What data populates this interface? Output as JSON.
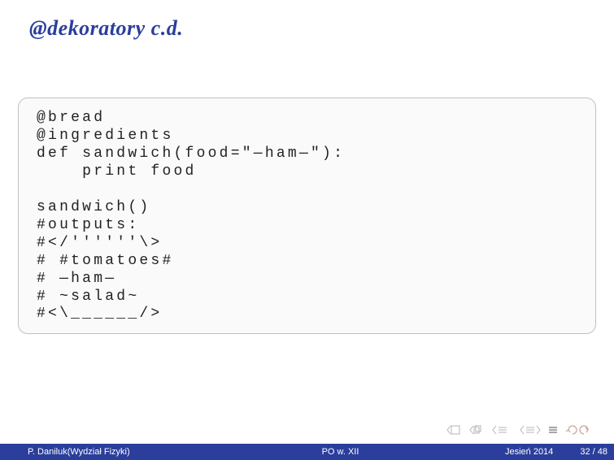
{
  "title": "@dekoratory c.d.",
  "code": {
    "l1": "@bread",
    "l2": "@ingredients",
    "l3": "def sandwich(food=\"—ham—\"):",
    "l4": "    print food",
    "l5": "sandwich()",
    "l6": "#outputs:",
    "l7": "#</''''''\\>",
    "l8": "# #tomatoes#",
    "l9": "# —ham—",
    "l10": "# ~salad~",
    "l11": "#<\\______/>"
  },
  "footer": {
    "author": "P. Daniluk(Wydział Fizyki)",
    "center": "PO w. XII",
    "term": "Jesień 2014",
    "page": "32 / 48"
  }
}
